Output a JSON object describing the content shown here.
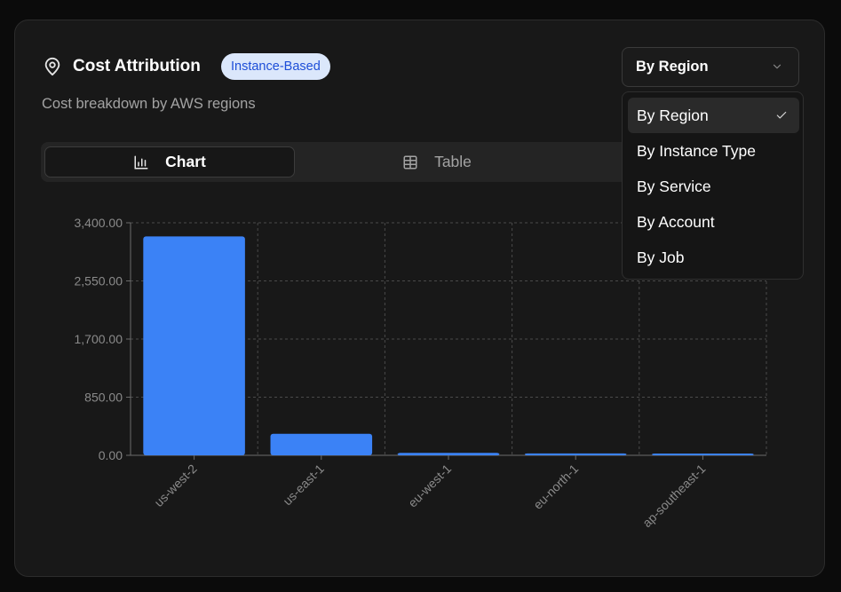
{
  "header": {
    "title": "Cost Attribution",
    "badge": "Instance-Based",
    "subtitle": "Cost breakdown by AWS regions",
    "icon": "map-pin-icon"
  },
  "select": {
    "value": "By Region",
    "options": [
      "By Region",
      "By Instance Type",
      "By Service",
      "By Account",
      "By Job"
    ],
    "selected_index": 0
  },
  "tabs": [
    {
      "label": "Chart",
      "icon": "bar-chart-icon",
      "active": true
    },
    {
      "label": "Table",
      "icon": "table-icon",
      "active": false
    }
  ],
  "colors": {
    "bar": "#3b82f6",
    "accent_badge_bg": "#dbe7fb",
    "accent_badge_text": "#1d4ed8"
  },
  "chart_data": {
    "type": "bar",
    "categories": [
      "us-west-2",
      "us-east-1",
      "eu-west-1",
      "eu-north-1",
      "ap-southeast-1"
    ],
    "values": [
      3200,
      315,
      35,
      28,
      18
    ],
    "ylim": [
      0,
      3400
    ],
    "yticks": [
      "0.00",
      "850.00",
      "1,700.00",
      "2,550.00",
      "3,400.00"
    ],
    "grid": true
  }
}
